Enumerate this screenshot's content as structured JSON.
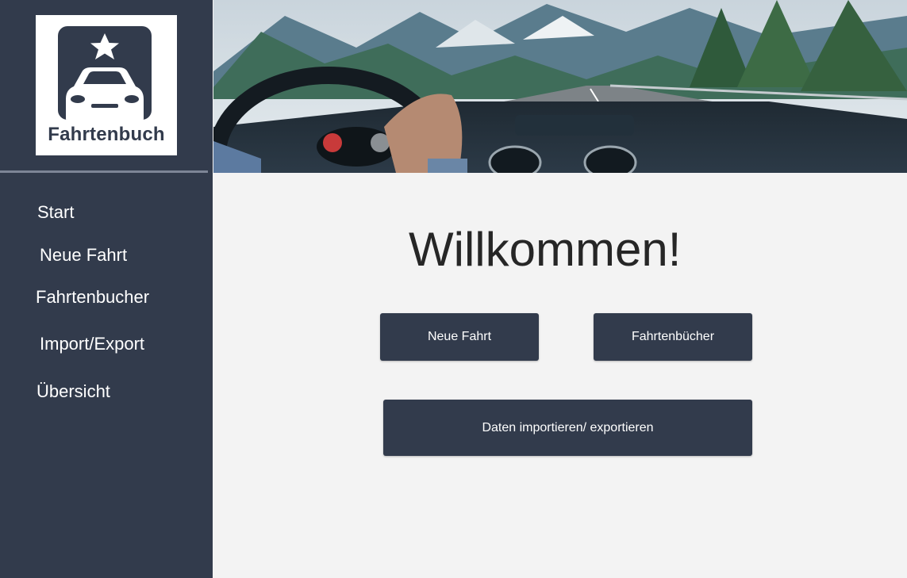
{
  "app": {
    "logo_text": "Fahrtenbuch"
  },
  "sidebar": {
    "items": [
      {
        "label": "Start"
      },
      {
        "label": "Neue Fahrt"
      },
      {
        "label": "Fahrtenbucher"
      },
      {
        "label": "Import/Export"
      },
      {
        "label": "Übersicht"
      }
    ]
  },
  "main": {
    "heading": "Willkommen!",
    "buttons": {
      "new_trip": "Neue Fahrt",
      "logbooks": "Fahrtenbücher",
      "import_export": "Daten importieren/ exportieren"
    }
  },
  "colors": {
    "sidebar_bg": "#323b4c",
    "content_bg": "#f3f3f3",
    "button_bg": "#323b4c",
    "button_text": "#ffffff"
  },
  "icons": [
    "car-logo-icon",
    "star-icon"
  ]
}
